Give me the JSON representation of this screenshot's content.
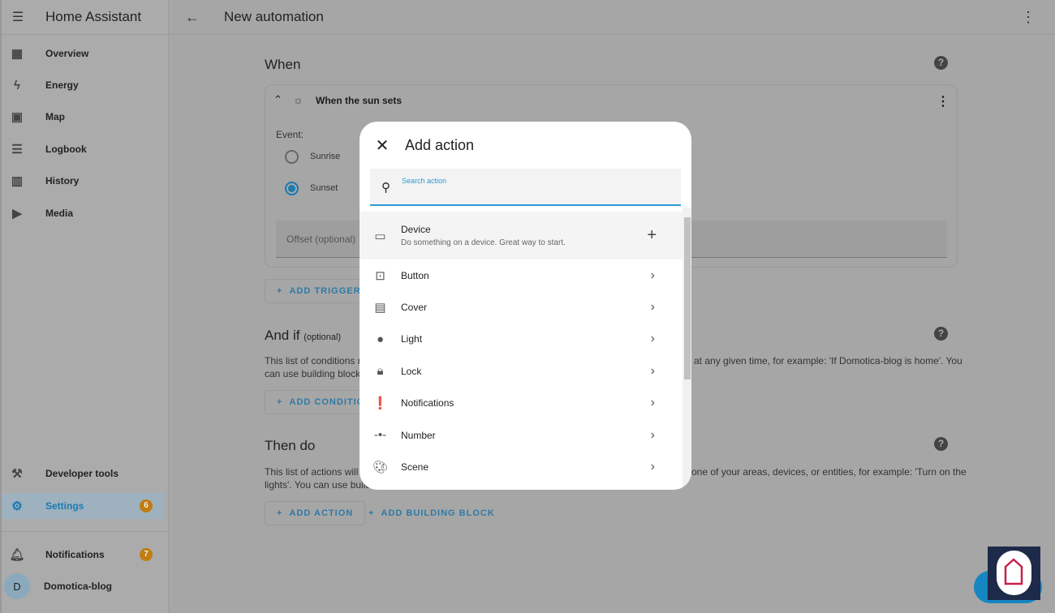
{
  "sidebar": {
    "app_title": "Home Assistant",
    "items": [
      {
        "label": "Overview",
        "icon": "view-dashboard-icon"
      },
      {
        "label": "Energy",
        "icon": "lightning-icon"
      },
      {
        "label": "Map",
        "icon": "map-icon"
      },
      {
        "label": "Logbook",
        "icon": "list-icon"
      },
      {
        "label": "History",
        "icon": "chart-box-icon"
      },
      {
        "label": "Media",
        "icon": "play-box-icon"
      }
    ],
    "developer_tools": "Developer tools",
    "settings": {
      "label": "Settings",
      "badge": "6"
    },
    "notifications": {
      "label": "Notifications",
      "badge": "7"
    },
    "user": {
      "initial": "D",
      "name": "Domotica-blog"
    }
  },
  "header": {
    "title": "New automation"
  },
  "when": {
    "title": "When",
    "trigger_title": "When the sun sets",
    "event_label": "Event:",
    "options": [
      "Sunrise",
      "Sunset"
    ],
    "selected": "Sunset",
    "offset_placeholder": "Offset (optional)",
    "add_trigger": "ADD TRIGGER"
  },
  "and_if": {
    "title": "And if",
    "optional": "(optional)",
    "desc_left1": "This list of conditions n",
    "desc_left2": "can use building blocks",
    "desc_right1": "at any given time, for example: 'If Domotica-blog is home'. You",
    "add_condition": "ADD CONDITION"
  },
  "then_do": {
    "title": "Then do",
    "desc_left1": "This list of actions will",
    "desc_left2": "lights'. You can use build",
    "desc_right1": "one of your areas, devices, or entities, for example: 'Turn on the",
    "add_action": "ADD ACTION",
    "add_building_block": "ADD BUILDING BLOCK"
  },
  "dialog": {
    "title": "Add action",
    "search_label": "Search action",
    "device": {
      "label": "Device",
      "description": "Do something on a device. Great way to start."
    },
    "items": [
      {
        "label": "Button",
        "icon": "gesture-tap-button-icon"
      },
      {
        "label": "Cover",
        "icon": "window-shutter-icon"
      },
      {
        "label": "Light",
        "icon": "lightbulb-icon"
      },
      {
        "label": "Lock",
        "icon": "lock-icon"
      },
      {
        "label": "Notifications",
        "icon": "message-alert-icon"
      },
      {
        "label": "Number",
        "icon": "ray-vertex-icon"
      },
      {
        "label": "Scene",
        "icon": "palette-icon"
      }
    ]
  },
  "colors": {
    "accent": "#1a7bb0",
    "badge": "#c27c10"
  }
}
